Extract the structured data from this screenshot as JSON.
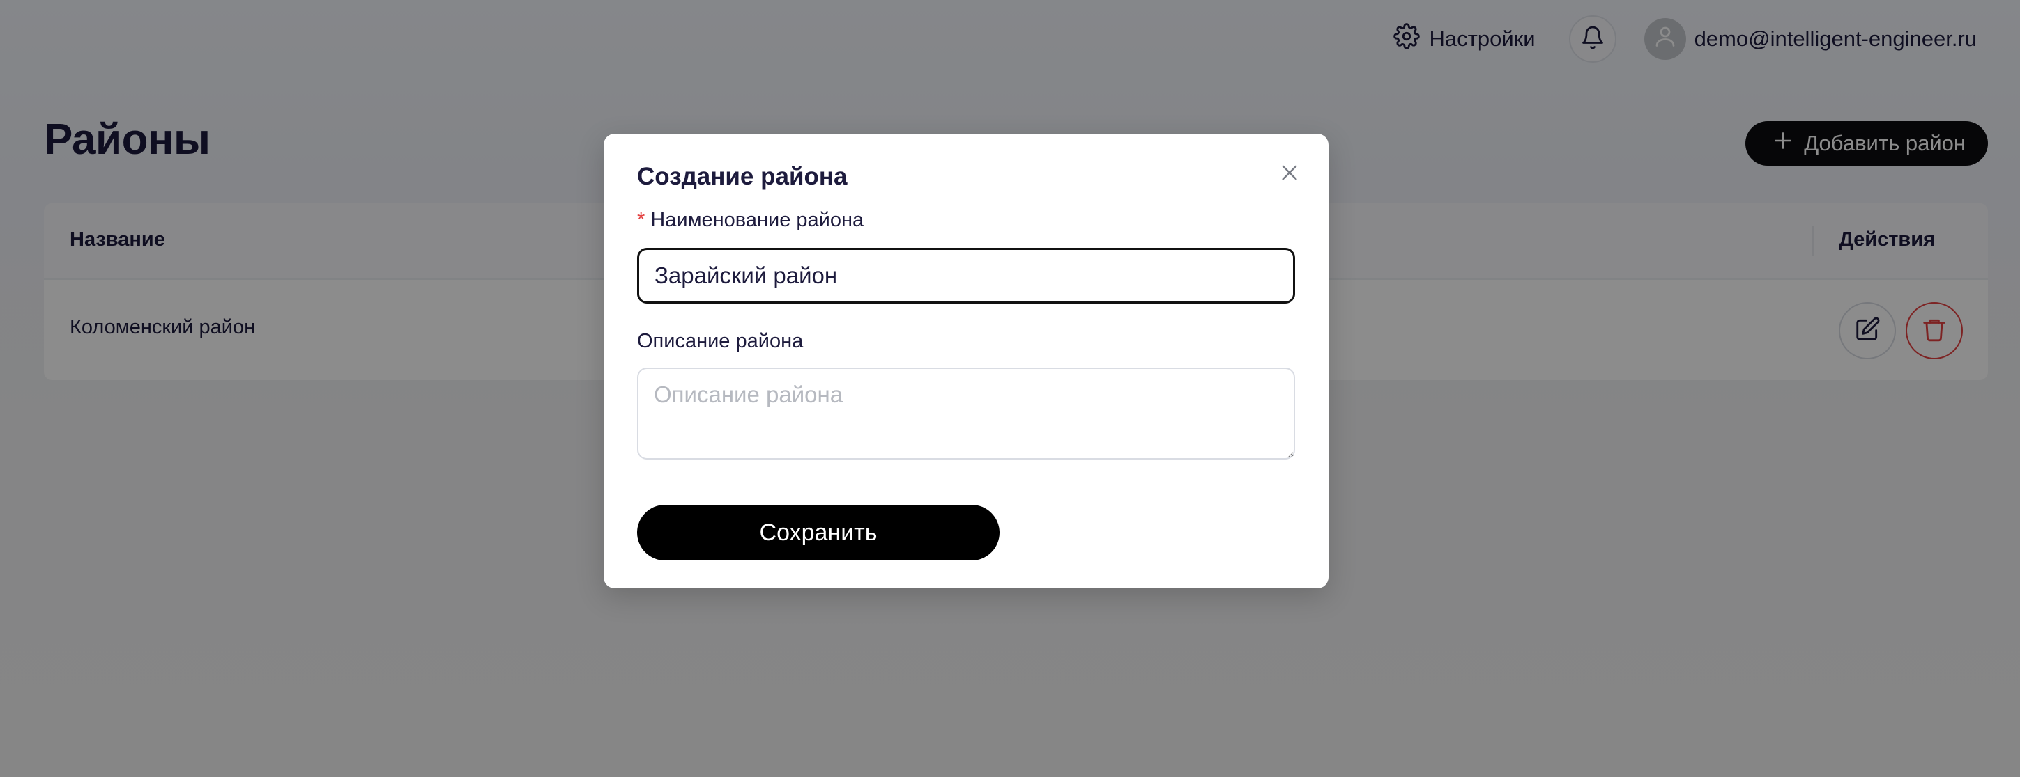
{
  "header": {
    "settings_label": "Настройки",
    "user_email": "demo@intelligent-engineer.ru"
  },
  "page": {
    "title": "Районы",
    "add_button_label": "Добавить район"
  },
  "table": {
    "columns": {
      "name": "Название",
      "actions": "Действия"
    },
    "rows": [
      {
        "name": "Коломенский район"
      }
    ]
  },
  "modal": {
    "title": "Создание района",
    "name_field": {
      "label": "Наименование района",
      "required_mark": "*",
      "value": "Зарайский район"
    },
    "description_field": {
      "label": "Описание района",
      "placeholder": "Описание района",
      "value": ""
    },
    "save_label": "Сохранить"
  },
  "colors": {
    "primary_button": "#000000",
    "danger": "#e34141",
    "text": "#1d1b3d"
  },
  "icons": {
    "settings": "gear-icon",
    "notifications": "bell-icon",
    "user": "user-icon",
    "add": "plus-icon",
    "edit": "edit-icon",
    "delete": "trash-icon",
    "close": "close-icon"
  }
}
